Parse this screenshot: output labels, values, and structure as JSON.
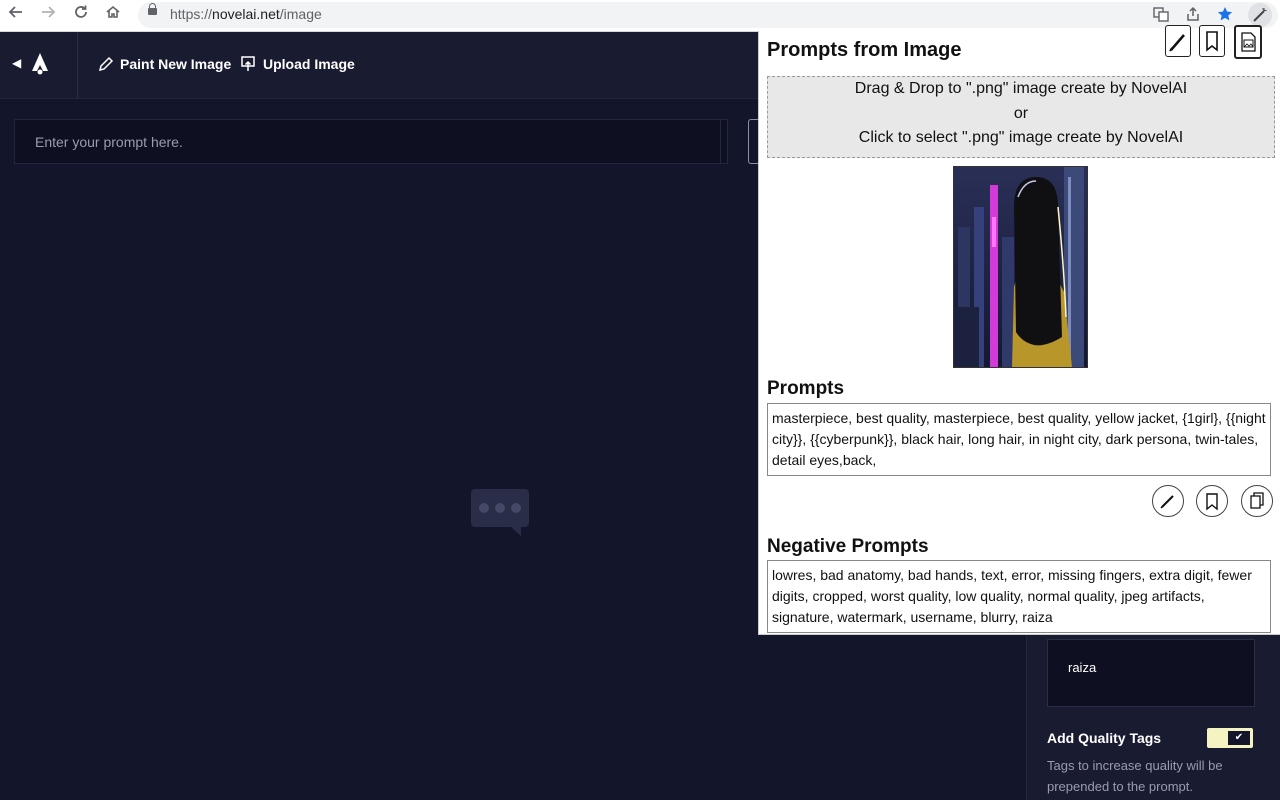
{
  "browser": {
    "url_prefix": "https://",
    "url_host": "novelai.net",
    "url_path": "/image",
    "back_icon": "arrow-left-icon",
    "forward_icon": "arrow-right-icon",
    "reload_icon": "reload-icon",
    "home_icon": "home-icon"
  },
  "app": {
    "paint_label": "Paint New Image",
    "upload_label": "Upload Image",
    "prompt_placeholder": "Enter your prompt here.",
    "negative_value": "raiza",
    "quality_tags_label": "Add Quality Tags",
    "quality_tags_desc": "Tags to increase quality will be prepended to the prompt.",
    "quality_tags_on": true
  },
  "popup": {
    "title": "Prompts from Image",
    "drop_line1": "Drag & Drop to \".png\" image create by NovelAI",
    "drop_line2": "or",
    "drop_line3": "Click to select \".png\" image create by NovelAI",
    "prompts_title": "Prompts",
    "prompts_text": "masterpiece, best quality, masterpiece, best quality, yellow jacket, {1girl}, {{night city}}, {{cyberpunk}}, black hair, long hair, in night city, dark persona, twin-tales, detail eyes,back,",
    "negative_title": "Negative Prompts",
    "negative_text": "lowres, bad anatomy, bad hands, text, error, missing fingers, extra digit, fewer digits, cropped, worst quality, low quality, normal quality, jpeg artifacts, signature, watermark, username, blurry, raiza"
  },
  "colors": {
    "app_bg": "#13152b",
    "header_bg": "#191b31",
    "toggle_on": "#f5f3c2",
    "star": "#1a73e8"
  }
}
